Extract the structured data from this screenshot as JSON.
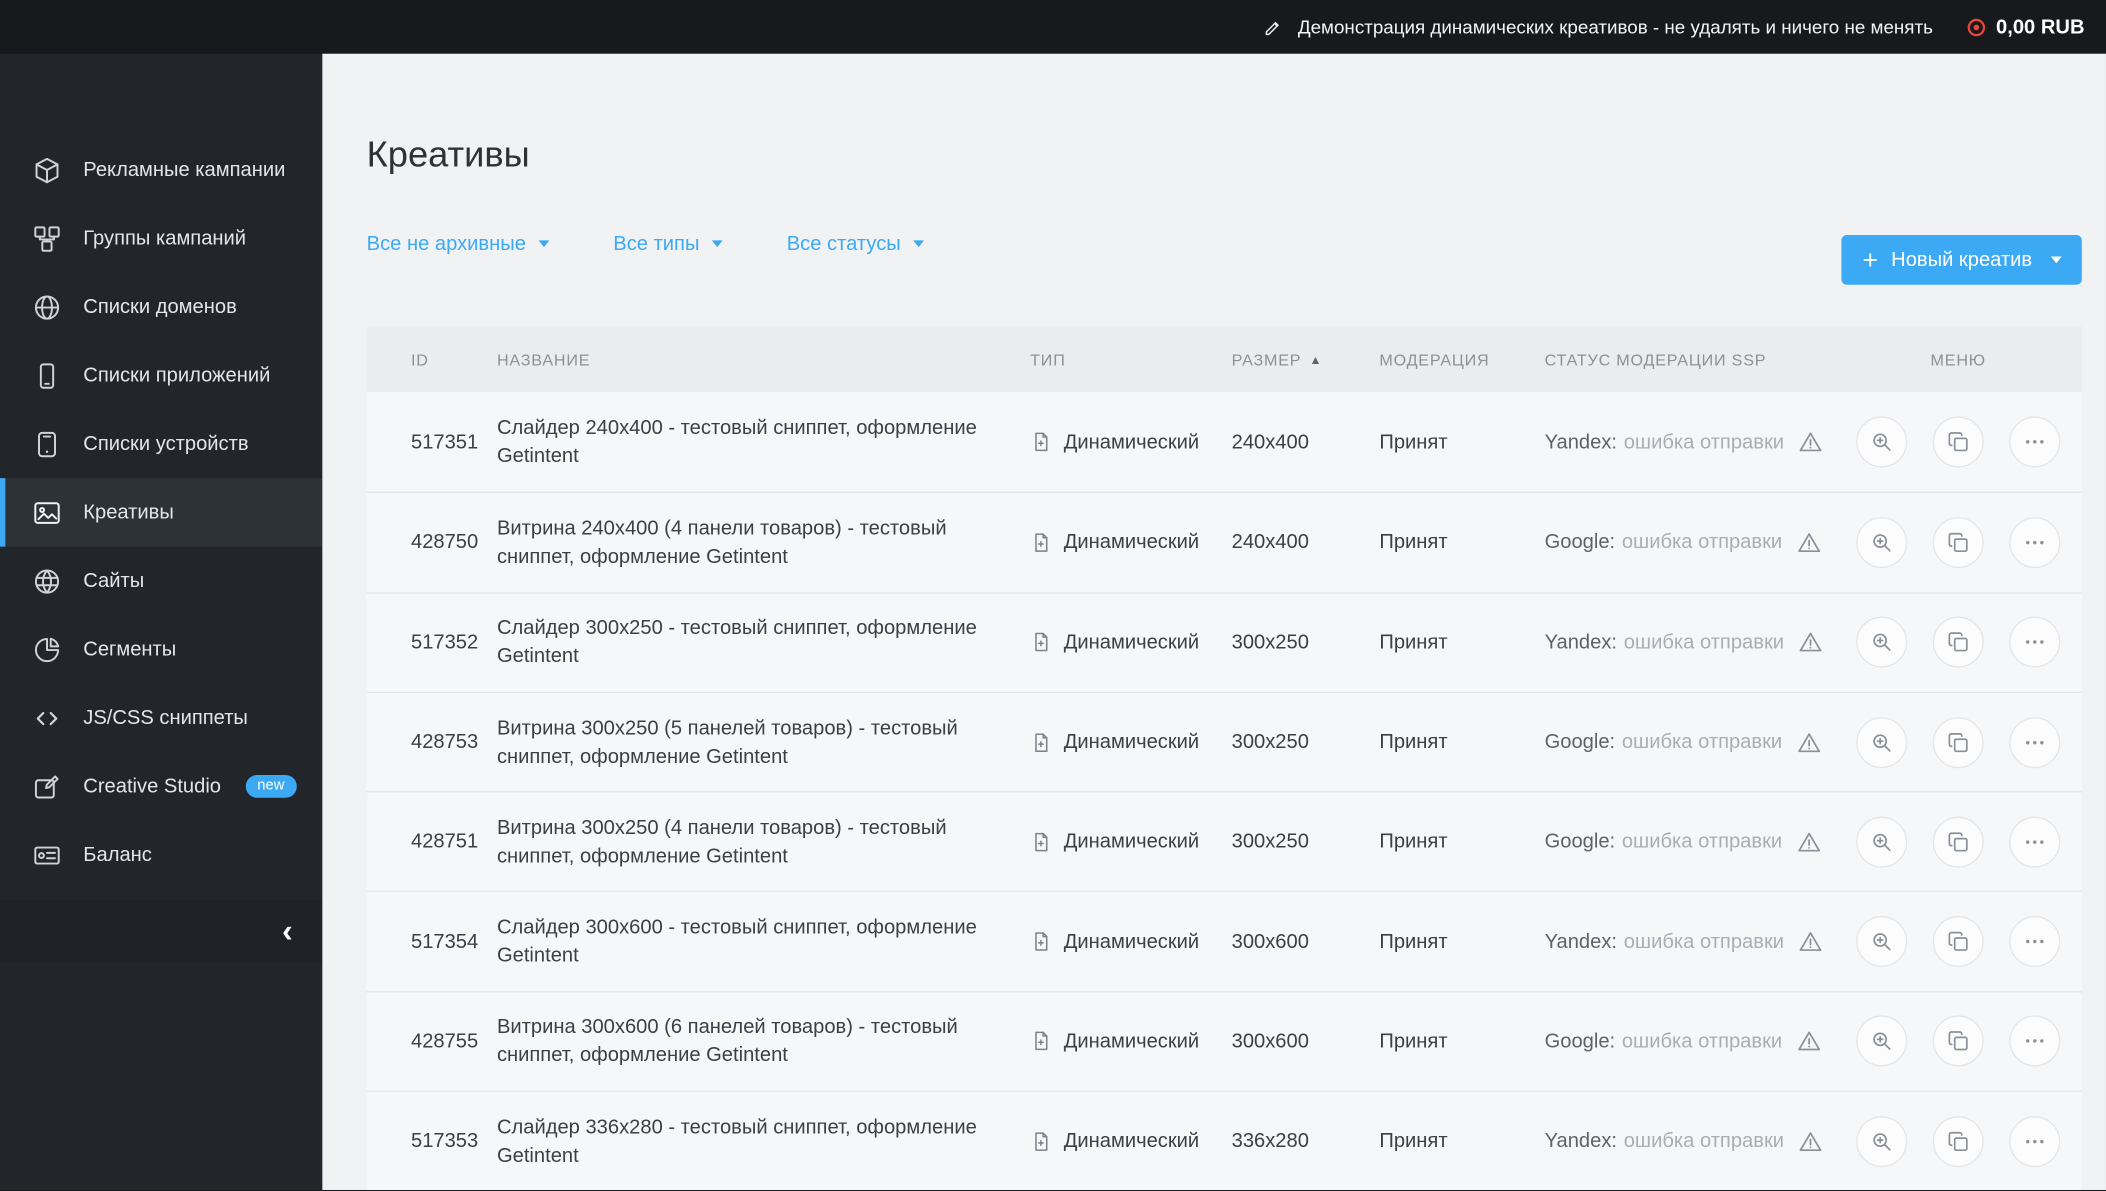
{
  "topbar": {
    "note": "Демонстрация динамических креативов - не удалять и ничего не менять",
    "balance": "0,00 RUB",
    "balance_icon_color": "#e8463c"
  },
  "sidebar": {
    "items": [
      {
        "label": "Рекламные кампании",
        "icon": "cube-icon"
      },
      {
        "label": "Группы кампаний",
        "icon": "cubes-icon"
      },
      {
        "label": "Списки доменов",
        "icon": "globe-icon"
      },
      {
        "label": "Списки приложений",
        "icon": "smartphone-icon"
      },
      {
        "label": "Списки устройств",
        "icon": "device-icon"
      },
      {
        "label": "Креативы",
        "icon": "image-icon",
        "active": true
      },
      {
        "label": "Сайты",
        "icon": "world-icon"
      },
      {
        "label": "Сегменты",
        "icon": "pie-icon"
      },
      {
        "label": "JS/CSS сниппеты",
        "icon": "code-icon"
      },
      {
        "label": "Creative Studio",
        "icon": "studio-icon",
        "badge": "new"
      },
      {
        "label": "Баланс",
        "icon": "balance-icon"
      }
    ]
  },
  "page": {
    "title": "Креативы",
    "filters": [
      {
        "label": "Все не архивные"
      },
      {
        "label": "Все типы"
      },
      {
        "label": "Все статусы"
      }
    ],
    "new_button_label": "Новый креатив",
    "accent_color": "#3ba9f4"
  },
  "table": {
    "headers": [
      "ID",
      "НАЗВАНИЕ",
      "ТИП",
      "РАЗМЕР",
      "МОДЕРАЦИЯ",
      "СТАТУС МОДЕРАЦИИ SSP",
      "МЕНЮ"
    ],
    "sort": {
      "column": "РАЗМЕР",
      "direction": "asc"
    },
    "rows": [
      {
        "id": "517351",
        "name": "Слайдер 240x400 - тестовый сниппет, оформление Getintent",
        "type": "Динамический",
        "size": "240x400",
        "moderation": "Принят",
        "ssp_network": "Yandex:",
        "ssp_status": "ошибка отправки"
      },
      {
        "id": "428750",
        "name": "Витрина 240x400 (4 панели товаров) - тестовый сниппет, оформление Getintent",
        "type": "Динамический",
        "size": "240x400",
        "moderation": "Принят",
        "ssp_network": "Google:",
        "ssp_status": "ошибка отправки"
      },
      {
        "id": "517352",
        "name": "Слайдер 300x250 - тестовый сниппет, оформление Getintent",
        "type": "Динамический",
        "size": "300x250",
        "moderation": "Принят",
        "ssp_network": "Yandex:",
        "ssp_status": "ошибка отправки"
      },
      {
        "id": "428753",
        "name": "Витрина 300x250 (5 панелей товаров) - тестовый сниппет, оформление Getintent",
        "type": "Динамический",
        "size": "300x250",
        "moderation": "Принят",
        "ssp_network": "Google:",
        "ssp_status": "ошибка отправки"
      },
      {
        "id": "428751",
        "name": "Витрина 300x250 (4 панели товаров) - тестовый сниппет, оформление Getintent",
        "type": "Динамический",
        "size": "300x250",
        "moderation": "Принят",
        "ssp_network": "Google:",
        "ssp_status": "ошибка отправки"
      },
      {
        "id": "517354",
        "name": "Слайдер 300x600 - тестовый сниппет, оформление Getintent",
        "type": "Динамический",
        "size": "300x600",
        "moderation": "Принят",
        "ssp_network": "Yandex:",
        "ssp_status": "ошибка отправки"
      },
      {
        "id": "428755",
        "name": "Витрина 300x600 (6 панелей товаров) - тестовый сниппет, оформление Getintent",
        "type": "Динамический",
        "size": "300x600",
        "moderation": "Принят",
        "ssp_network": "Google:",
        "ssp_status": "ошибка отправки"
      },
      {
        "id": "517353",
        "name": "Слайдер 336x280 - тестовый сниппет, оформление Getintent",
        "type": "Динамический",
        "size": "336x280",
        "moderation": "Принят",
        "ssp_network": "Yandex:",
        "ssp_status": "ошибка отправки"
      }
    ]
  }
}
